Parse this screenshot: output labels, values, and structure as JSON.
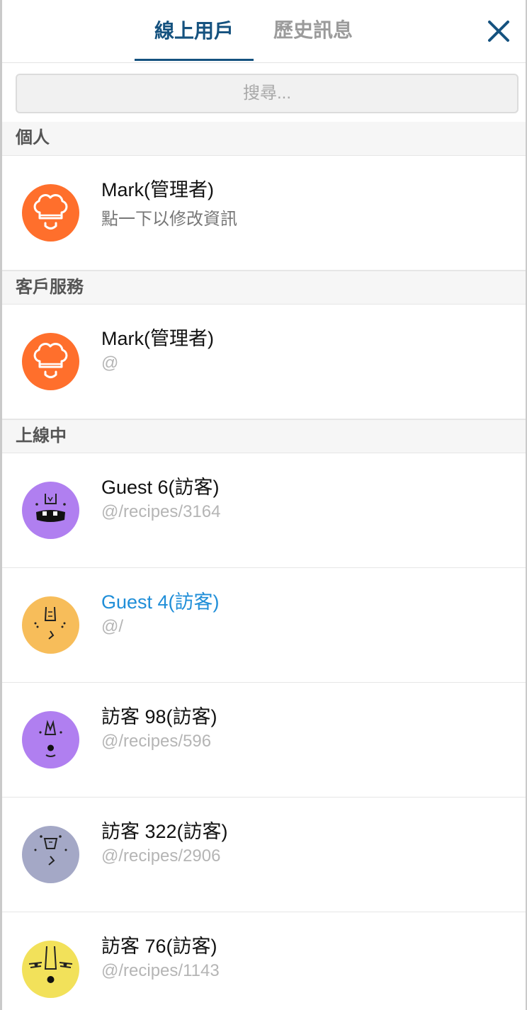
{
  "tabs": [
    {
      "label": "線上用戶",
      "active": true
    },
    {
      "label": "歷史訊息",
      "active": false
    }
  ],
  "close_icon": "close-icon",
  "search": {
    "placeholder": "搜尋...",
    "value": ""
  },
  "colors": {
    "accent": "#15527f",
    "highlight": "#1f8ed8",
    "admin_avatar": "#ff6f2c",
    "purple_avatar": "#b07ff0",
    "orange_avatar": "#f7bd5a",
    "slate_avatar": "#a4a8c6",
    "yellow_avatar": "#f2e15a"
  },
  "sections": {
    "personal": {
      "title": "個人",
      "user": {
        "name": "Mark(管理者)",
        "sub": "點一下以修改資訊",
        "avatar": "chef-hat-avatar"
      }
    },
    "support": {
      "title": "客戶服務",
      "user": {
        "name": "Mark(管理者)",
        "sub": "@",
        "avatar": "chef-hat-avatar"
      }
    },
    "online": {
      "title": "上線中",
      "users": [
        {
          "name": "Guest 6(訪客)",
          "sub": "@/recipes/3164",
          "avatar": "purple-monster-avatar"
        },
        {
          "name": "Guest 4(訪客)",
          "sub": "@/",
          "avatar": "orange-face-avatar",
          "highlighted": true
        },
        {
          "name": "訪客 98(訪客)",
          "sub": "@/recipes/596",
          "avatar": "purple-face-avatar"
        },
        {
          "name": "訪客 322(訪客)",
          "sub": "@/recipes/2906",
          "avatar": "slate-face-avatar"
        },
        {
          "name": "訪客 76(訪客)",
          "sub": "@/recipes/1143",
          "avatar": "yellow-face-avatar"
        }
      ]
    }
  }
}
